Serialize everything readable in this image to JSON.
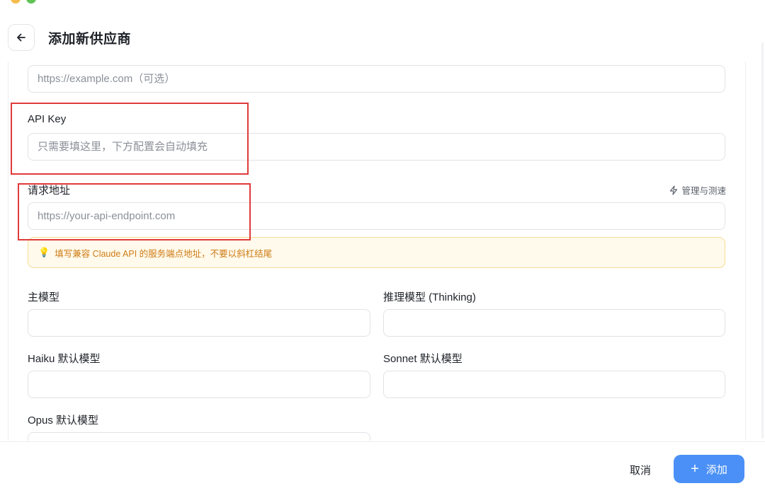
{
  "header": {
    "title": "添加新供应商",
    "back_icon": "arrow-left-icon"
  },
  "form": {
    "website": {
      "placeholder": "https://example.com（可选）",
      "value": ""
    },
    "api_key": {
      "label": "API Key",
      "placeholder": "只需要填这里，下方配置会自动填充",
      "value": ""
    },
    "endpoint": {
      "label": "请求地址",
      "placeholder": "https://your-api-endpoint.com",
      "value": "",
      "manage_label": "管理与测速",
      "manage_icon": "lightning-icon",
      "hint": "填写兼容 Claude API 的服务端点地址，不要以斜杠结尾",
      "hint_icon": "lightbulb-icon"
    },
    "main_model": {
      "label": "主模型",
      "value": ""
    },
    "thinking_model": {
      "label": "推理模型 (Thinking)",
      "value": ""
    },
    "haiku_model": {
      "label": "Haiku 默认模型",
      "value": ""
    },
    "sonnet_model": {
      "label": "Sonnet 默认模型",
      "value": ""
    },
    "opus_model": {
      "label": "Opus 默认模型",
      "value": ""
    }
  },
  "footer": {
    "cancel_label": "取消",
    "add_label": "添加",
    "add_icon": "plus-icon"
  },
  "colors": {
    "accent": "#4a90f7",
    "annotation": "#e03a3a",
    "hint_text": "#cf7c17",
    "hint_bg": "#fffaeb"
  }
}
